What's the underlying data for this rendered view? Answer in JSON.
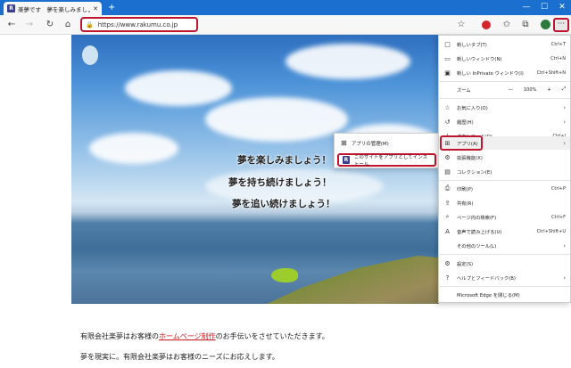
{
  "browser": {
    "tab_title": "楽夢です　夢を楽しみましょう！",
    "tab_favicon": "R",
    "new_tab": "+",
    "window_controls": [
      "—",
      "☐",
      "✕"
    ],
    "url": "https://www.rakumu.co.jp"
  },
  "hero": {
    "lines": [
      "夢を楽しみましょう！",
      "夢を持ち続けましょう！",
      "夢を追い続けましょう！"
    ]
  },
  "body": {
    "line1_pre": "有限会社楽夢はお客様の",
    "line1_link": "ホームページ制作",
    "line1_post": "のお手伝いをさせていただきます。",
    "line2": "夢を現実に。有限会社楽夢はお客様のニーズにお応えします。"
  },
  "apps_submenu": {
    "items": [
      {
        "label": "アプリの管理(M)",
        "icon": "apps-grid-icon"
      },
      {
        "label": "このサイトをアプリとしてインストール",
        "icon": "site-app-icon",
        "badge": "R"
      }
    ]
  },
  "menu": {
    "items": [
      {
        "label": "新しいタブ(T)",
        "shortcut": "Ctrl+T",
        "icon": "□"
      },
      {
        "label": "新しいウィンドウ(N)",
        "shortcut": "Ctrl+N",
        "icon": "▭"
      },
      {
        "label": "新しい InPrivate ウィンドウ(I)",
        "shortcut": "Ctrl+Shift+N",
        "icon": "▣"
      },
      {
        "label": "お気に入り(O)",
        "shortcut": "",
        "icon": "☆",
        "arrow": "›"
      },
      {
        "label": "履歴(H)",
        "shortcut": "",
        "icon": "↺",
        "arrow": "›"
      },
      {
        "label": "ダウンロード(D)",
        "shortcut": "Ctrl+J",
        "icon": "↓"
      },
      {
        "label": "アプリ(A)",
        "shortcut": "",
        "icon": "⊞",
        "arrow": "›"
      },
      {
        "label": "拡張機能(X)",
        "shortcut": "",
        "icon": "⚙"
      },
      {
        "label": "コレクション(E)",
        "shortcut": "",
        "icon": "▤"
      },
      {
        "label": "印刷(P)",
        "shortcut": "Ctrl+P",
        "icon": "⎙"
      },
      {
        "label": "共有(R)",
        "shortcut": "",
        "icon": "⇪"
      },
      {
        "label": "ページ内の検索(F)",
        "shortcut": "Ctrl+F",
        "icon": "⌕"
      },
      {
        "label": "音声で読み上げる(U)",
        "shortcut": "Ctrl+Shift+U",
        "icon": "A"
      },
      {
        "label": "その他のツール(L)",
        "shortcut": "",
        "icon": "",
        "arrow": "›"
      },
      {
        "label": "設定(S)",
        "shortcut": "",
        "icon": "⚙"
      },
      {
        "label": "ヘルプとフィードバック(B)",
        "shortcut": "",
        "icon": "?",
        "arrow": "›"
      },
      {
        "label": "Microsoft Edge を閉じる(M)",
        "shortcut": "",
        "icon": ""
      }
    ],
    "zoom": {
      "label": "ズーム",
      "minus": "—",
      "value": "100%",
      "plus": "+",
      "fullscreen": "⤢"
    }
  }
}
